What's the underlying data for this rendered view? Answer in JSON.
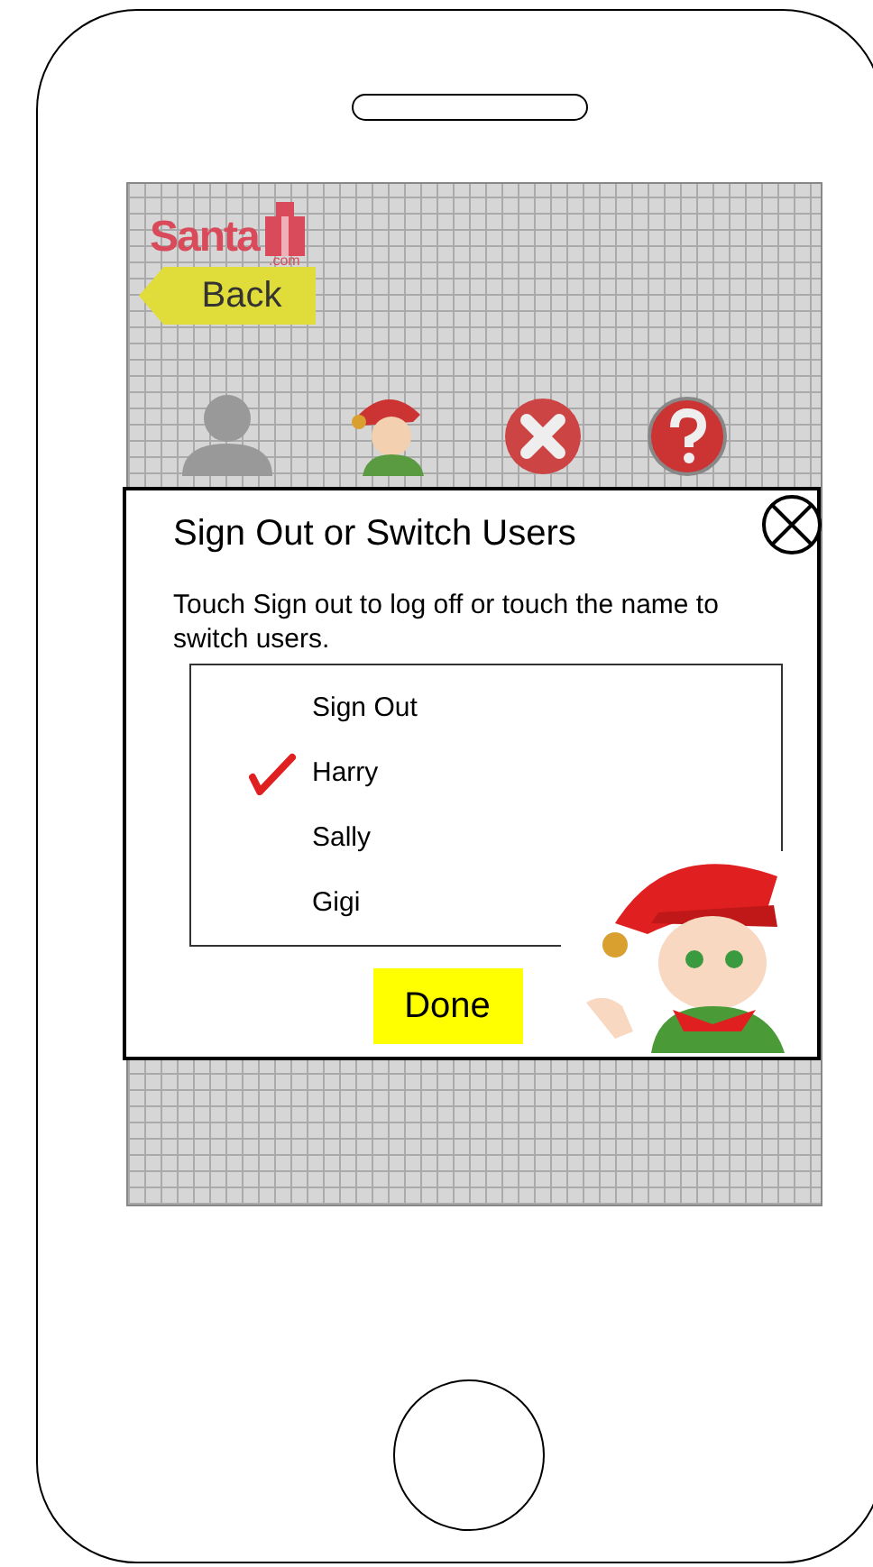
{
  "logo": {
    "name": "Santa",
    "domain": ".com"
  },
  "back_button": {
    "label": "Back"
  },
  "dialog": {
    "title": "Sign Out or Switch Users",
    "message": "Touch Sign out to log off or touch the name to switch users.",
    "options": [
      {
        "label": "Sign Out",
        "selected": false
      },
      {
        "label": "Harry",
        "selected": true
      },
      {
        "label": "Sally",
        "selected": false
      },
      {
        "label": "Gigi",
        "selected": false
      }
    ],
    "done_button": "Done"
  }
}
